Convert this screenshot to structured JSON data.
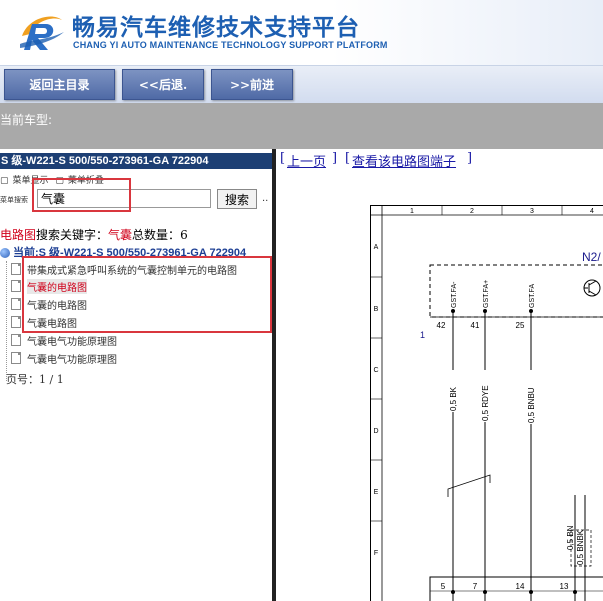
{
  "header": {
    "title_cn": "畅易汽车维修技术支持平台",
    "title_en": "CHANG YI AUTO MAINTENANCE TECHNOLOGY SUPPORT PLATFORM",
    "brand_colors": {
      "primary": "#1d5fb2",
      "accent": "#f0a020"
    }
  },
  "nav": {
    "back_main": "返回主目录",
    "back": "<<后退.",
    "forward": ">>前进"
  },
  "carbar": {
    "label": "当前车型:"
  },
  "left": {
    "model_title": "S 级-W221-S 500/550-273961-GA 722904",
    "menu_show": "菜单显示",
    "menu_collapse": "菜单折叠",
    "search_label": "菜单搜索",
    "search_value": "气囊",
    "search_button": "搜索",
    "search_more": "..",
    "result_prefix": "电路图",
    "result_label": "搜索关键字：",
    "result_keyword": "气囊",
    "result_count_label": "总数量：",
    "result_count": "6",
    "current_label": "当前:S 级-W221-S 500/550-273961-GA 722904",
    "items": [
      "带集成式紧急呼叫系统的气囊控制单元的电路图",
      "气囊的电路图",
      "气囊的电路图",
      "气囊电路图",
      "气囊电气功能原理图",
      "气囊电气功能原理图"
    ],
    "selected_index": 1,
    "page_label": "页号：",
    "page_value": "1 / 1"
  },
  "right": {
    "prev_page": "上一页",
    "view_terminals": "查看该电路图端子",
    "diagram": {
      "col_numbers": [
        "1",
        "2",
        "3",
        "4"
      ],
      "row_letters": [
        "A",
        "B",
        "C",
        "D",
        "E",
        "F"
      ],
      "component": "N2/",
      "pin_labels": [
        "GST.FA-",
        "GST.FA+",
        "GST.FA"
      ],
      "pin_numbers": [
        "42",
        "41",
        "25"
      ],
      "connector_ref": "1",
      "wire_labels": [
        "0,5 BK",
        "0,5 RDYE",
        "0,5 BNBU"
      ],
      "wire_labels_right": [
        "0,5 BN",
        "0,5 BNBK"
      ],
      "bottom_pins": [
        "5",
        "7",
        "14",
        "13"
      ]
    }
  }
}
